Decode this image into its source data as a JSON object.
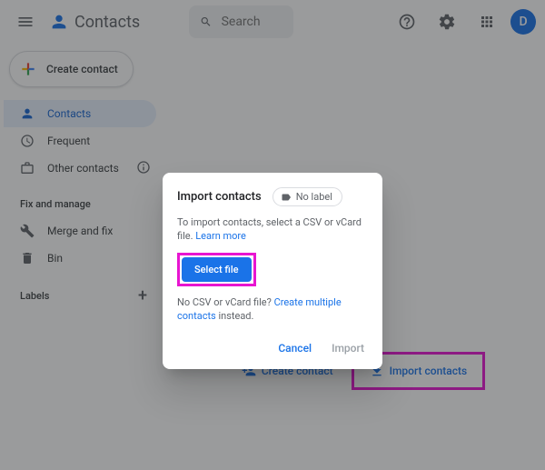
{
  "header": {
    "app_name": "Contacts",
    "search_placeholder": "Search",
    "avatar_letter": "D"
  },
  "sidebar": {
    "create_label": "Create contact",
    "items": [
      {
        "label": "Contacts"
      },
      {
        "label": "Frequent"
      },
      {
        "label": "Other contacts"
      }
    ],
    "fix_section": "Fix and manage",
    "fix_items": [
      {
        "label": "Merge and fix"
      },
      {
        "label": "Bin"
      }
    ],
    "labels_title": "Labels"
  },
  "empty": {
    "create": "Create contact",
    "import": "Import contacts"
  },
  "dialog": {
    "title": "Import contacts",
    "no_label": "No label",
    "body_prefix": "To import contacts, select a CSV or vCard file. ",
    "learn_more": "Learn more",
    "select_file": "Select file",
    "nocsv_prefix": "No CSV or vCard file? ",
    "create_multiple": "Create multiple contacts",
    "nocsv_suffix": " instead.",
    "cancel": "Cancel",
    "import": "Import"
  }
}
